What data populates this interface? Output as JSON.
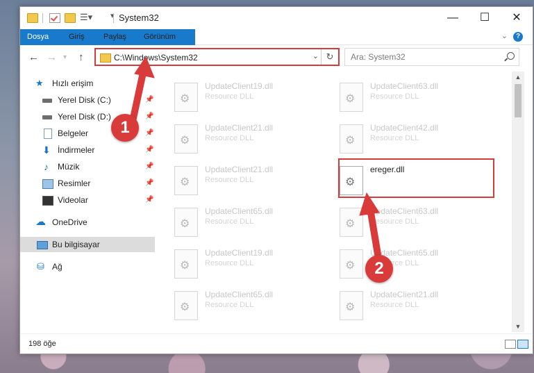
{
  "window": {
    "title": "System32"
  },
  "ribbon": {
    "tabs": [
      "Dosya",
      "Giriş",
      "Paylaş",
      "Görünüm"
    ]
  },
  "navbar": {
    "address": "C:\\Windows\\System32",
    "search_placeholder": "Ara: System32"
  },
  "sidebar": {
    "items": [
      {
        "label": "Hızlı erişim",
        "icon": "star-icon"
      },
      {
        "label": "Yerel Disk (C:)",
        "icon": "drive-icon"
      },
      {
        "label": "Yerel Disk (D:)",
        "icon": "drive-icon"
      },
      {
        "label": "Belgeler",
        "icon": "document-icon"
      },
      {
        "label": "İndirmeler",
        "icon": "download-icon"
      },
      {
        "label": "Müzik",
        "icon": "music-icon"
      },
      {
        "label": "Resimler",
        "icon": "pictures-icon"
      },
      {
        "label": "Videolar",
        "icon": "video-icon"
      },
      {
        "label": "OneDrive",
        "icon": "cloud-icon"
      },
      {
        "label": "Bu bilgisayar",
        "icon": "computer-icon"
      },
      {
        "label": "Ağ",
        "icon": "network-icon"
      }
    ]
  },
  "files": [
    {
      "name": "UpdateClient19.dll",
      "type": "Resource DLL"
    },
    {
      "name": "UpdateClient63.dll",
      "type": "Resource DLL"
    },
    {
      "name": "UpdateClient21.dll",
      "type": "Resource DLL"
    },
    {
      "name": "UpdateClient42.dll",
      "type": "Resource DLL"
    },
    {
      "name": "UpdateClient21.dll",
      "type": "Resource DLL"
    },
    {
      "name": "ereger.dll",
      "type": ""
    },
    {
      "name": "UpdateClient65.dll",
      "type": "Resource DLL"
    },
    {
      "name": "UpdateClient63.dll",
      "type": "Resource DLL"
    },
    {
      "name": "UpdateClient19.dll",
      "type": "Resource DLL"
    },
    {
      "name": "UpdateClient65.dll",
      "type": "Resource DLL"
    },
    {
      "name": "UpdateClient65.dll",
      "type": "Resource DLL"
    },
    {
      "name": "UpdateClient21.dll",
      "type": "Resource DLL"
    }
  ],
  "status": {
    "item_count": "198 öğe"
  },
  "annotations": {
    "step1": "1",
    "step2": "2",
    "color": "#d93a3a"
  }
}
